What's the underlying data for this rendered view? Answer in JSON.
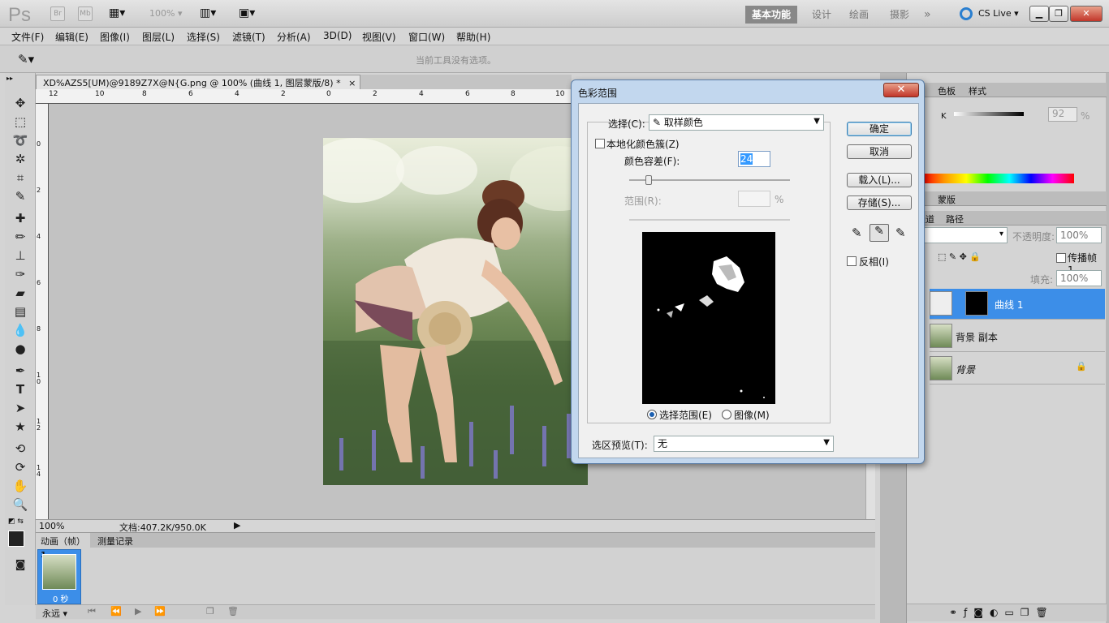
{
  "appbar": {
    "logo": "Ps",
    "bridge": "Br",
    "minibridge": "Mb",
    "zoom": "100%",
    "workspaces": [
      "基本功能",
      "设计",
      "绘画",
      "摄影"
    ],
    "more": "»",
    "cslive": "CS Live"
  },
  "window_controls": {
    "minimize": "▁",
    "restore": "❐",
    "close": "✕"
  },
  "menu": [
    "文件(F)",
    "编辑(E)",
    "图像(I)",
    "图层(L)",
    "选择(S)",
    "滤镜(T)",
    "分析(A)",
    "3D(D)",
    "视图(V)",
    "窗口(W)",
    "帮助(H)"
  ],
  "options_bar": {
    "message": "当前工具没有选项。"
  },
  "document": {
    "tab_title": "XD%AZS5[UM)@9189Z7X@N{G.png @ 100% (曲线 1, 图层蒙版/8) *",
    "close": "×",
    "ruler_h": [
      "12",
      "10",
      "8",
      "6",
      "4",
      "2",
      "0",
      "2",
      "4",
      "6",
      "8",
      "10"
    ],
    "ruler_v": [
      "0",
      "2",
      "4",
      "6",
      "8",
      "10",
      "12",
      "14"
    ]
  },
  "status": {
    "zoom": "100%",
    "doc_size": "文档:407.2K/950.0K"
  },
  "animation_panel": {
    "tabs": [
      "动画（帧）",
      "测量记录"
    ],
    "frame_number": "1",
    "frame_delay": "0 秒",
    "loop": "永远"
  },
  "dialog": {
    "title": "色彩范围",
    "close": "✕",
    "select_label": "选择(C):",
    "select_value": "取样颜色",
    "localized_label": "本地化颜色簇(Z)",
    "localized_checked": false,
    "fuzziness_label": "颜色容差(F):",
    "fuzziness_value": "24",
    "fuzziness_fraction": 0.12,
    "range_label": "范围(R):",
    "range_unit": "%",
    "radio_selection": "选择范围(E)",
    "radio_image": "图像(M)",
    "radio_selected": "selection",
    "preview_label": "选区预览(T):",
    "preview_value": "无",
    "ok": "确定",
    "cancel": "取消",
    "load": "载入(L)...",
    "save": "存储(S)...",
    "invert_label": "反相(I)",
    "invert_checked": false
  },
  "right_panels": {
    "color_tabs": [
      "色板",
      "样式"
    ],
    "k_label": "K",
    "k_value": "92",
    "k_unit": "%",
    "adjust_tabs": [
      "蒙版"
    ],
    "layer_tabs": [
      "通道",
      "路径"
    ],
    "blend_mode": "常",
    "opacity_label": "不透明度:",
    "opacity_value": "100%",
    "propagate_label": "传播帧 1",
    "fill_label": "填充:",
    "fill_value": "100%",
    "layers": [
      {
        "name": "曲线 1",
        "selected": true
      },
      {
        "name": "背景 副本",
        "selected": false
      },
      {
        "name": "背景",
        "selected": false
      }
    ]
  },
  "colors": {
    "accent": "#3c8ee8",
    "dialog_frame": "#c2d7ee",
    "selected_layer": "#3c8ee8"
  }
}
